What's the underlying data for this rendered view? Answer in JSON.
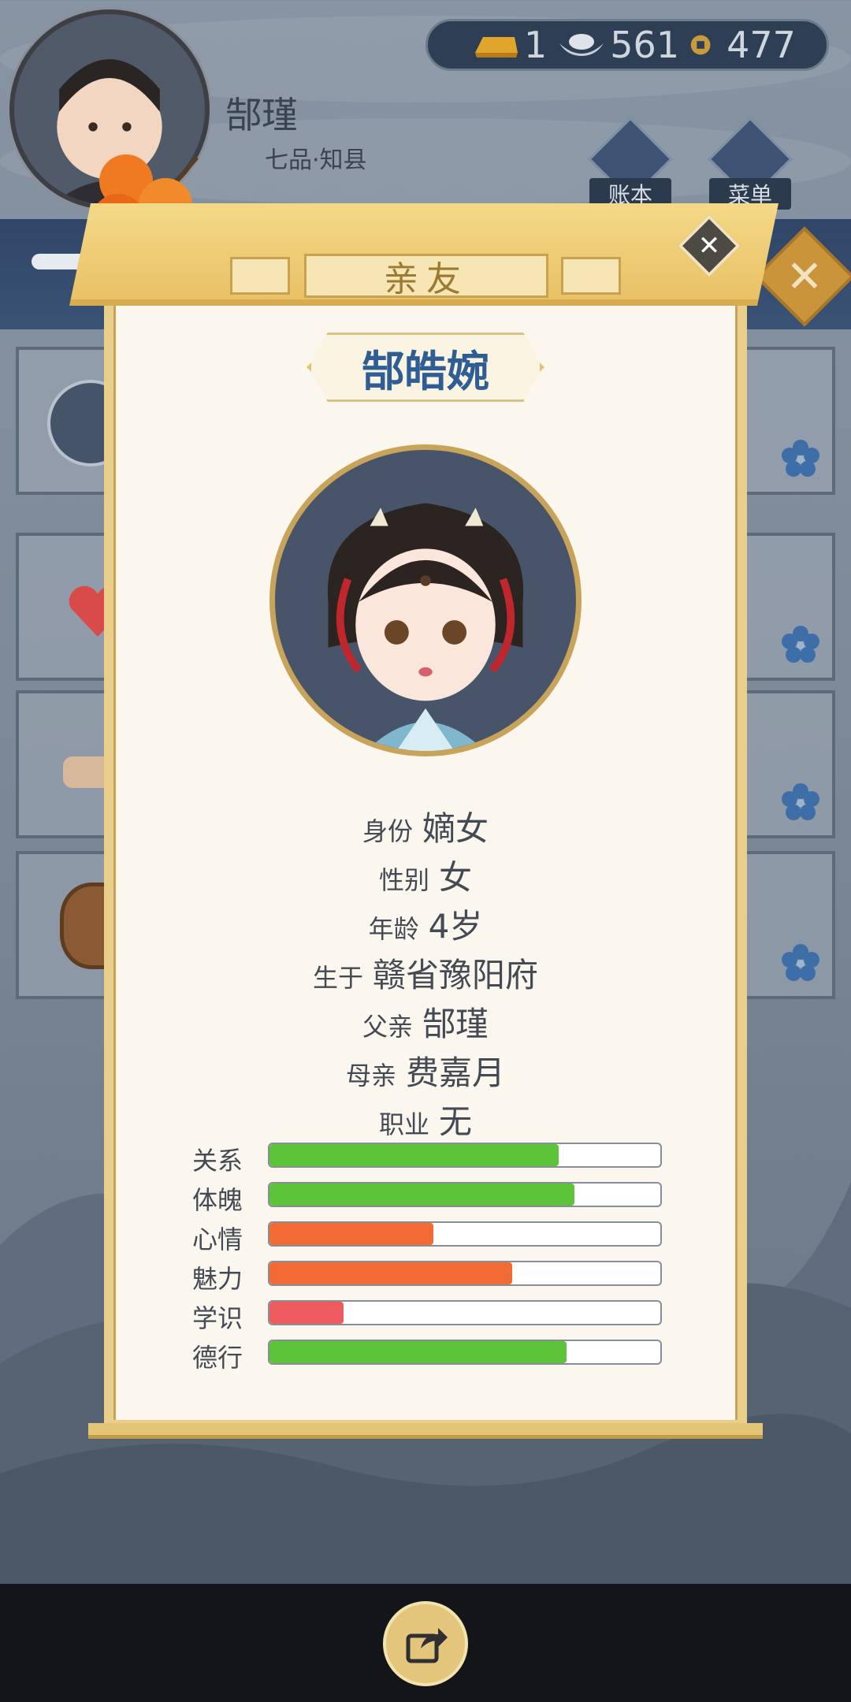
{
  "player": {
    "name": "郜瑾",
    "rank": "七品·知县"
  },
  "currency": {
    "gold": "1",
    "silver": "561",
    "coins": "477"
  },
  "top_menu": [
    {
      "label": "账本",
      "icon": "ledger-icon"
    },
    {
      "label": "菜单",
      "icon": "dots-menu-icon"
    }
  ],
  "dialog": {
    "title": "亲友",
    "person_name": "郜皓婉",
    "info": [
      {
        "key": "身份",
        "value": "嫡女"
      },
      {
        "key": "性别",
        "value": "女"
      },
      {
        "key": "年龄",
        "value": "4岁"
      },
      {
        "key": "生于",
        "value": "赣省豫阳府"
      },
      {
        "key": "父亲",
        "value": "郜瑾"
      },
      {
        "key": "母亲",
        "value": "费嘉月"
      },
      {
        "key": "职业",
        "value": "无"
      }
    ],
    "stats": [
      {
        "label": "关系",
        "percent": 74,
        "color": "#5dc43a"
      },
      {
        "label": "体魄",
        "percent": 78,
        "color": "#5dc43a"
      },
      {
        "label": "心情",
        "percent": 42,
        "color": "#f26b35"
      },
      {
        "label": "魅力",
        "percent": 62,
        "color": "#f26b35"
      },
      {
        "label": "学识",
        "percent": 19,
        "color": "#ee5a5e"
      },
      {
        "label": "德行",
        "percent": 76,
        "color": "#5dc43a"
      }
    ]
  },
  "colors": {
    "accent_gold": "#e9c166",
    "name_blue": "#2e5e93",
    "nav_bg": "#141518"
  }
}
